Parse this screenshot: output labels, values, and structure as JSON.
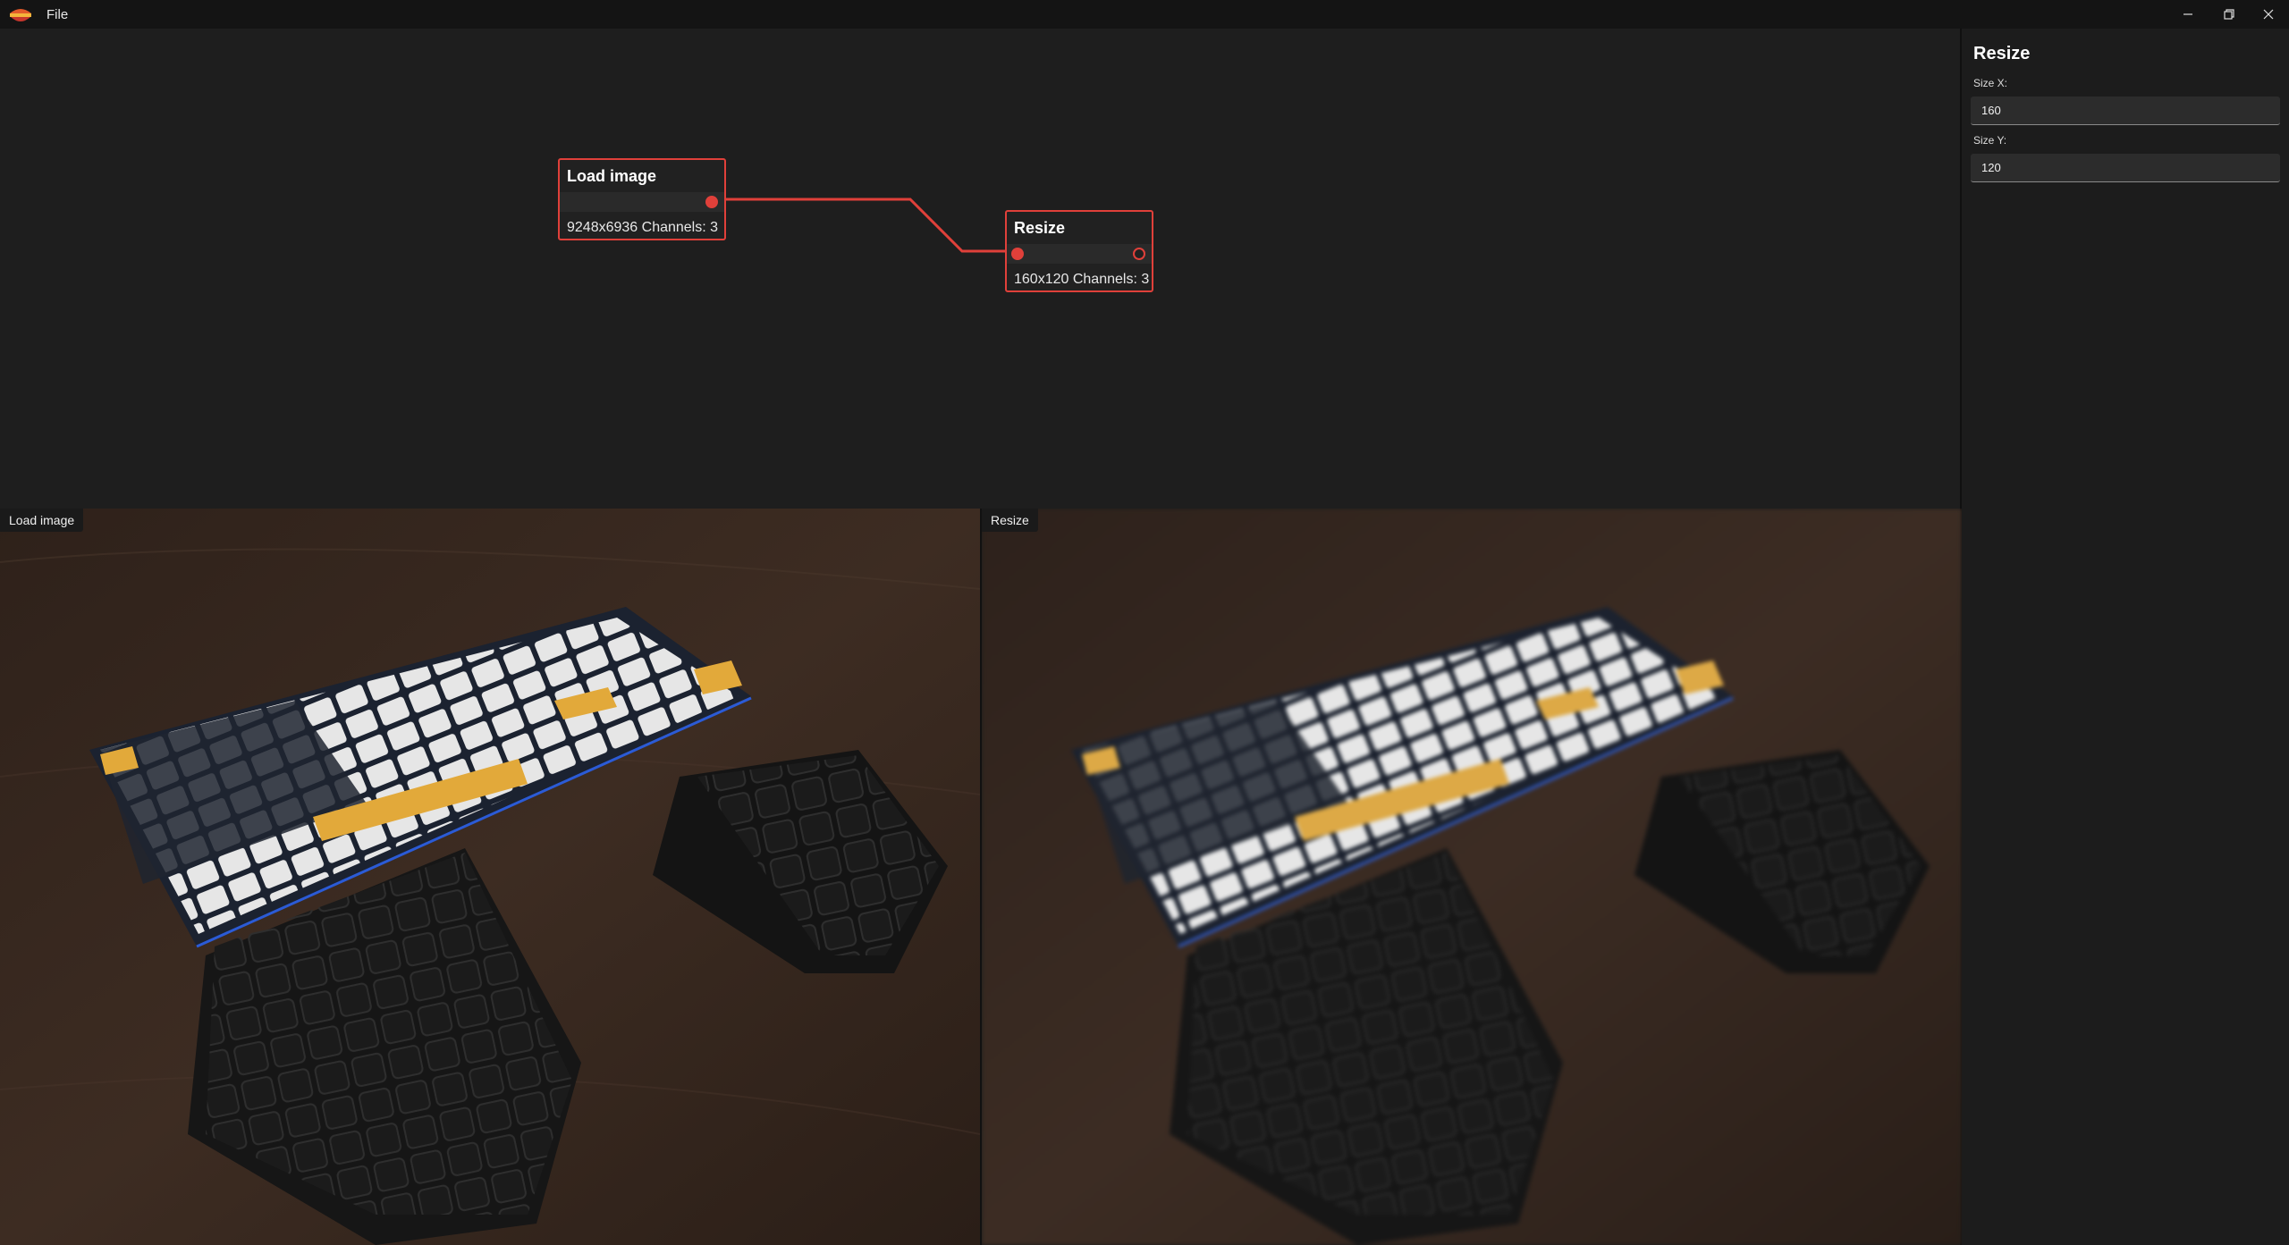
{
  "window": {
    "menu": {
      "file_label": "File"
    },
    "controls": {
      "minimize": "minimize-icon",
      "restore": "restore-icon",
      "close": "close-icon"
    }
  },
  "graph": {
    "nodes": [
      {
        "title": "Load image",
        "info": "9248x6936 Channels: 3"
      },
      {
        "title": "Resize",
        "info": "160x120 Channels: 3"
      }
    ]
  },
  "properties": {
    "title": "Resize",
    "size_x": {
      "label": "Size X:",
      "value": "160"
    },
    "size_y": {
      "label": "Size Y:",
      "value": "120"
    }
  },
  "previews": [
    {
      "label": "Load image"
    },
    {
      "label": "Resize"
    }
  ],
  "colors": {
    "accent": "#e0403a",
    "keycap_yellow": "#e2a93a",
    "desk": "#3a2a20"
  }
}
